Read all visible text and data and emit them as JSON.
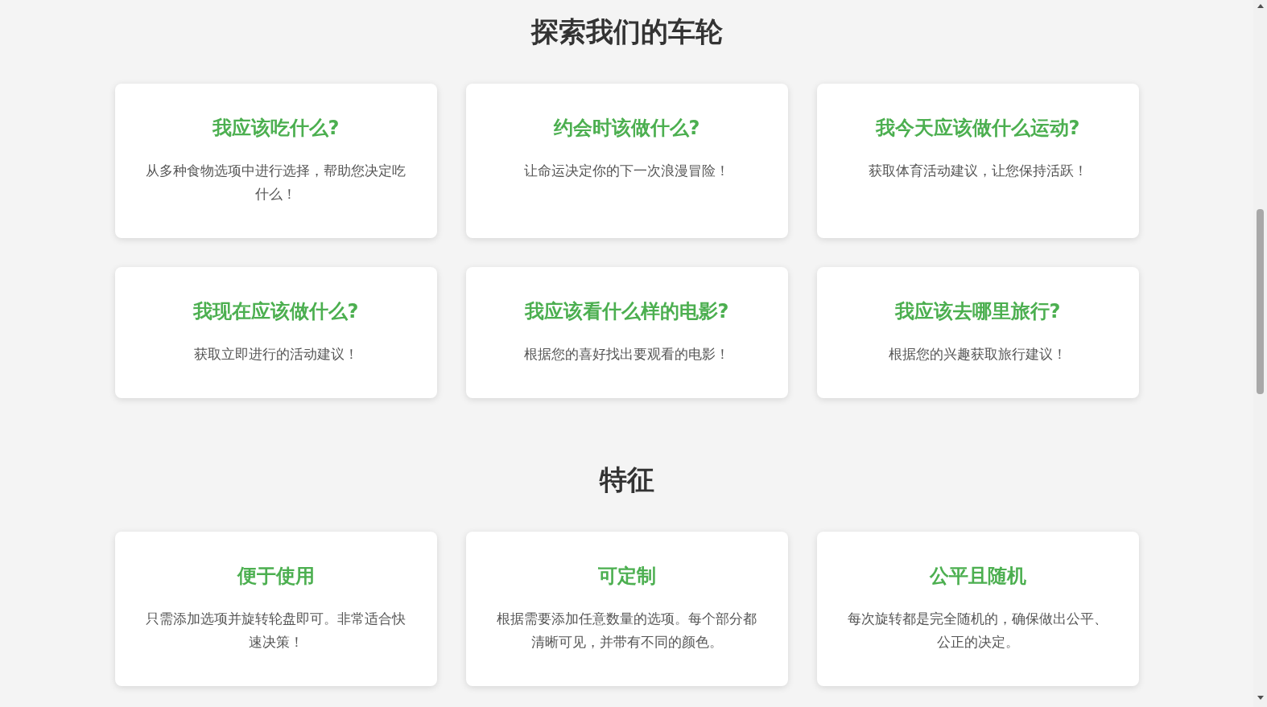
{
  "sections": [
    {
      "title": "探索我们的车轮",
      "cards": [
        {
          "title": "我应该吃什么?",
          "description": "从多种食物选项中进行选择，帮助您决定吃什么！"
        },
        {
          "title": "约会时该做什么?",
          "description": "让命运决定你的下一次浪漫冒险！"
        },
        {
          "title": "我今天应该做什么运动?",
          "description": "获取体育活动建议，让您保持活跃！"
        },
        {
          "title": "我现在应该做什么?",
          "description": "获取立即进行的活动建议！"
        },
        {
          "title": "我应该看什么样的电影?",
          "description": "根据您的喜好找出要观看的电影！"
        },
        {
          "title": "我应该去哪里旅行?",
          "description": "根据您的兴趣获取旅行建议！"
        }
      ]
    },
    {
      "title": "特征",
      "cards": [
        {
          "title": "便于使用",
          "description": "只需添加选项并旋转轮盘即可。非常适合快速决策！"
        },
        {
          "title": "可定制",
          "description": "根据需要添加任意数量的选项。每个部分都清晰可见，并带有不同的颜色。"
        },
        {
          "title": "公平且随机",
          "description": "每次旋转都是完全随机的，确保做出公平、公正的决定。"
        }
      ]
    }
  ]
}
